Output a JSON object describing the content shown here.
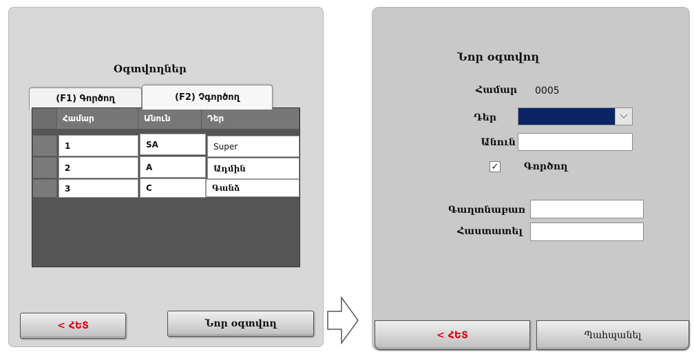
{
  "left": {
    "title": "Օգտվողներ",
    "tabs": [
      {
        "label": "(F1) Գործող"
      },
      {
        "label": "(F2) Չգործող"
      }
    ],
    "grid": {
      "columns": [
        "Համար",
        "Անուն",
        "Դեր"
      ],
      "rows": [
        [
          "1",
          "SA",
          "Super"
        ],
        [
          "2",
          "A",
          "Ադմին"
        ],
        [
          "3",
          "C",
          "Գանձ"
        ]
      ]
    },
    "back_label": "< ՀԵՏ",
    "new_user_label": "Նոր օգտվող"
  },
  "right": {
    "title": "Նոր օգտվող",
    "number_label": "Համար",
    "number_value": "0005",
    "role_label": "Դեր",
    "name_label": "Անուն",
    "active_label": "Գործող",
    "active_checked": true,
    "password_label": "Գաղտնաբառ",
    "confirm_label": "Հաստատել",
    "back_label": "< ՀԵՏ",
    "save_label": "Պահպանել"
  },
  "colors": {
    "role_select": "#0a2466",
    "back_text": "#e0001a"
  }
}
